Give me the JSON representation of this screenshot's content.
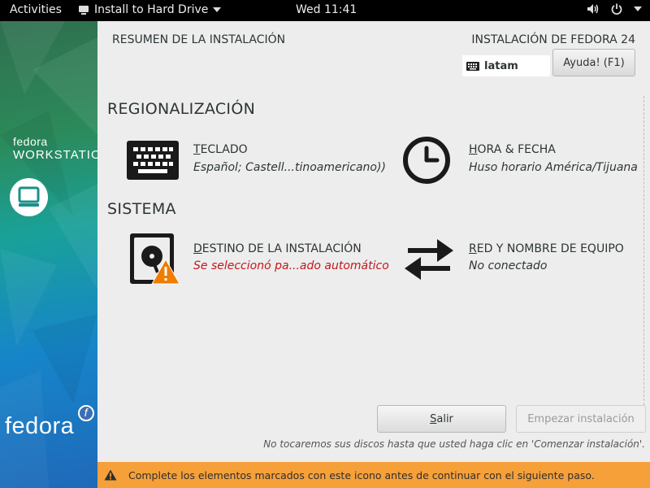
{
  "topbar": {
    "activities": "Activities",
    "app_name": "Install to Hard Drive",
    "clock": "Wed 11:41"
  },
  "sidebar": {
    "brand_small": "fedora",
    "brand_edition": "WORKSTATION",
    "brand_bottom": "fedora"
  },
  "header": {
    "summary_title": "RESUMEN DE LA INSTALACIÓN",
    "product_title": "INSTALACIÓN DE FEDORA 24",
    "keyboard_layout": "latam",
    "help_button": "Ayuda! (F1)"
  },
  "categories": {
    "localization": "REGIONALIZACIÓN",
    "system": "SISTEMA"
  },
  "spokes": {
    "keyboard": {
      "title_u": "T",
      "title_rest": "ECLADO",
      "status": "Español; Castell...tinoamericano))"
    },
    "datetime": {
      "title_u": "H",
      "title_rest": "ORA & FECHA",
      "status": "Huso horario América/Tijuana"
    },
    "destination": {
      "title_u": "D",
      "title_rest": "ESTINO DE LA INSTALACIÓN",
      "status": "Se seleccionó pa...ado automático"
    },
    "network": {
      "title_u": "R",
      "title_rest": "ED Y NOMBRE DE EQUIPO",
      "status": "No conectado"
    }
  },
  "actions": {
    "quit_u": "S",
    "quit_rest": "alir",
    "begin": "Empezar instalación",
    "note": "No tocaremos sus discos hasta que usted haga clic en 'Comenzar instalación'."
  },
  "warning_bar": {
    "text": "Complete los elementos marcados con este icono antes de continuar con el siguiente paso."
  },
  "colors": {
    "warning_bg": "#f6a03a",
    "error_text": "#c4161c",
    "main_bg": "#ededed"
  }
}
